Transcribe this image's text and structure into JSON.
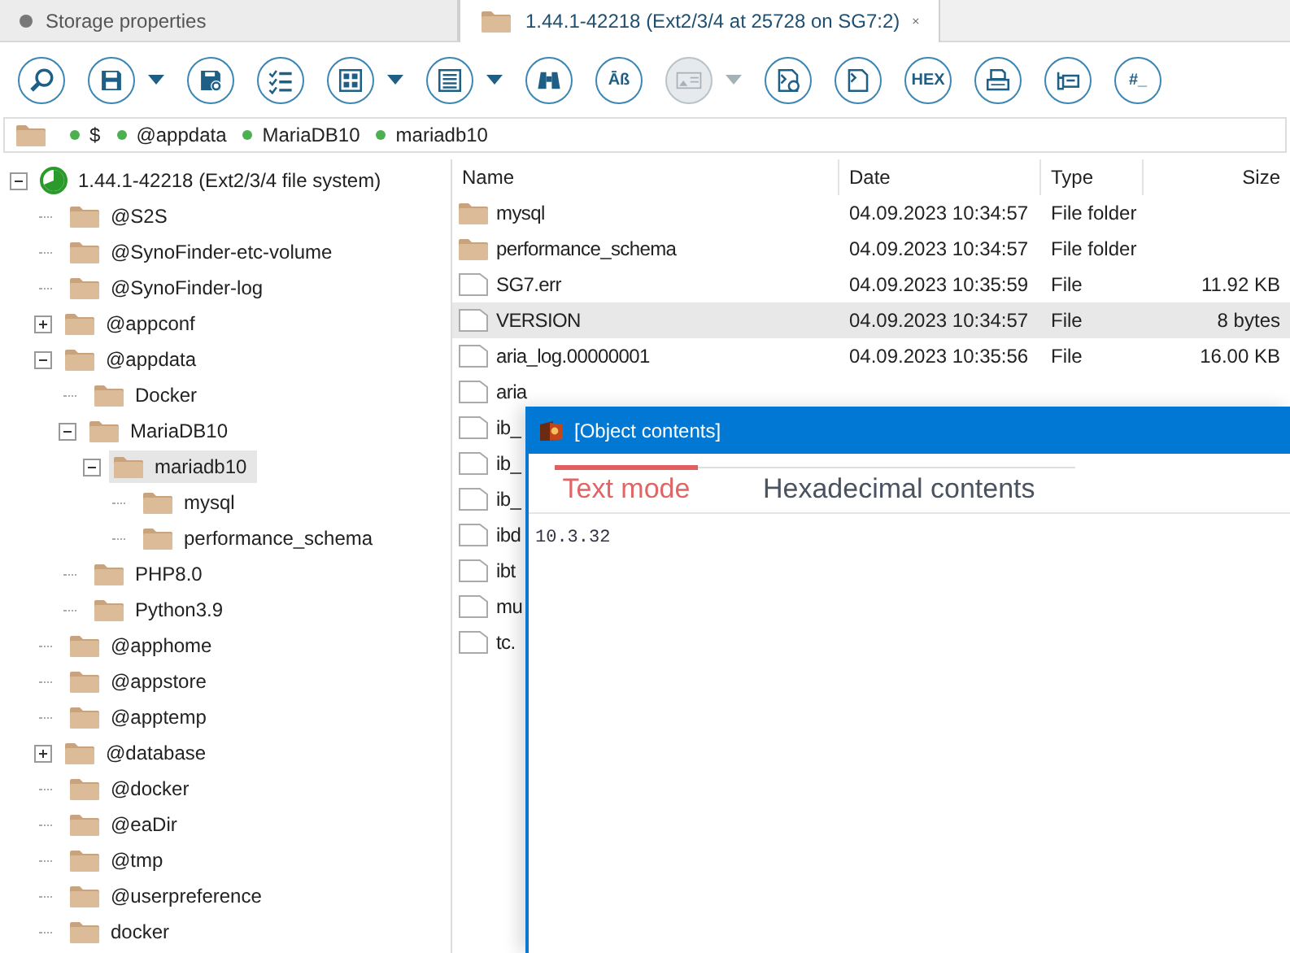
{
  "tabs": [
    {
      "label": "Storage properties",
      "selected": false,
      "closable": false
    },
    {
      "label": "1.44.1-42218 (Ext2/3/4 at 25728 on SG7:2)",
      "selected": true,
      "closable": true
    }
  ],
  "toolbar": [
    {
      "kind": "zoom",
      "disabled": false
    },
    {
      "kind": "save",
      "disabled": false,
      "menu": true
    },
    {
      "kind": "settings-file",
      "disabled": false
    },
    {
      "kind": "checklist",
      "disabled": false
    },
    {
      "kind": "grid",
      "disabled": false,
      "menu": true
    },
    {
      "kind": "list",
      "disabled": false,
      "menu": true
    },
    {
      "kind": "binoculars",
      "disabled": false
    },
    {
      "kind": "text",
      "label": "Āß",
      "disabled": false
    },
    {
      "kind": "image",
      "disabled": true,
      "menu": true
    },
    {
      "kind": "file-settings",
      "disabled": false
    },
    {
      "kind": "file",
      "disabled": false
    },
    {
      "kind": "text",
      "label": "HEX",
      "disabled": false
    },
    {
      "kind": "print",
      "disabled": false
    },
    {
      "kind": "export",
      "disabled": false
    },
    {
      "kind": "text",
      "label": "#_",
      "disabled": false
    }
  ],
  "breadcrumb": [
    "$",
    "@appdata",
    "MariaDB10",
    "mariadb10"
  ],
  "tree": {
    "items": [
      {
        "label": "1.44.1-42218 (Ext2/3/4 file system)",
        "kind": "disk",
        "expanded": true,
        "selected": false,
        "children": [
          {
            "label": "@S2S",
            "selected": false
          },
          {
            "label": "@SynoFinder-etc-volume",
            "selected": false
          },
          {
            "label": "@SynoFinder-log",
            "selected": false
          },
          {
            "label": "@appconf",
            "expanded": false,
            "selected": false
          },
          {
            "label": "@appdata",
            "expanded": true,
            "selected": false,
            "children": [
              {
                "label": "Docker",
                "selected": false
              },
              {
                "label": "MariaDB10",
                "expanded": true,
                "selected": false,
                "children": [
                  {
                    "label": "mariadb10",
                    "expanded": true,
                    "selected": true,
                    "children": [
                      {
                        "label": "mysql",
                        "selected": false
                      },
                      {
                        "label": "performance_schema",
                        "selected": false
                      }
                    ]
                  }
                ]
              },
              {
                "label": "PHP8.0",
                "selected": false
              },
              {
                "label": "Python3.9",
                "selected": false
              }
            ]
          },
          {
            "label": "@apphome",
            "selected": false
          },
          {
            "label": "@appstore",
            "selected": false
          },
          {
            "label": "@apptemp",
            "selected": false
          },
          {
            "label": "@database",
            "expanded": false,
            "selected": false
          },
          {
            "label": "@docker",
            "selected": false
          },
          {
            "label": "@eaDir",
            "selected": false
          },
          {
            "label": "@tmp",
            "selected": false
          },
          {
            "label": "@userpreference",
            "selected": false
          },
          {
            "label": "docker",
            "selected": false
          }
        ]
      }
    ]
  },
  "file_list": {
    "columns": [
      "Name",
      "Date",
      "Type",
      "Size"
    ],
    "rows": [
      {
        "kind": "folder",
        "name": "mysql",
        "date": "04.09.2023 10:34:57",
        "type": "File folder",
        "selected": false
      },
      {
        "kind": "folder",
        "name": "performance_schema",
        "date": "04.09.2023 10:34:57",
        "type": "File folder",
        "selected": false
      },
      {
        "kind": "file",
        "name": "SG7.err",
        "date": "04.09.2023 10:35:59",
        "type": "File",
        "size": "11.92 KB",
        "selected": false
      },
      {
        "kind": "file",
        "name": "VERSION",
        "date": "04.09.2023 10:34:57",
        "type": "File",
        "size": "8 bytes",
        "selected": true
      },
      {
        "kind": "file",
        "name": "aria_log.00000001",
        "date": "04.09.2023 10:35:56",
        "type": "File",
        "size": "16.00 KB",
        "selected": false
      },
      {
        "kind": "file",
        "name": "aria",
        "selected": false
      },
      {
        "kind": "file",
        "name": "ib_",
        "selected": false
      },
      {
        "kind": "file",
        "name": "ib_",
        "selected": false
      },
      {
        "kind": "file",
        "name": "ib_",
        "selected": false
      },
      {
        "kind": "file",
        "name": "ibd",
        "selected": false
      },
      {
        "kind": "file",
        "name": "ibt",
        "selected": false
      },
      {
        "kind": "file",
        "name": "mu",
        "selected": false
      },
      {
        "kind": "file",
        "name": "tc.",
        "selected": false
      }
    ]
  },
  "dialog": {
    "title": "[Object contents]",
    "tabs": [
      {
        "label": "Text mode",
        "selected": true
      },
      {
        "label": "Hexadecimal contents",
        "selected": false
      }
    ],
    "content": "10.3.32"
  }
}
